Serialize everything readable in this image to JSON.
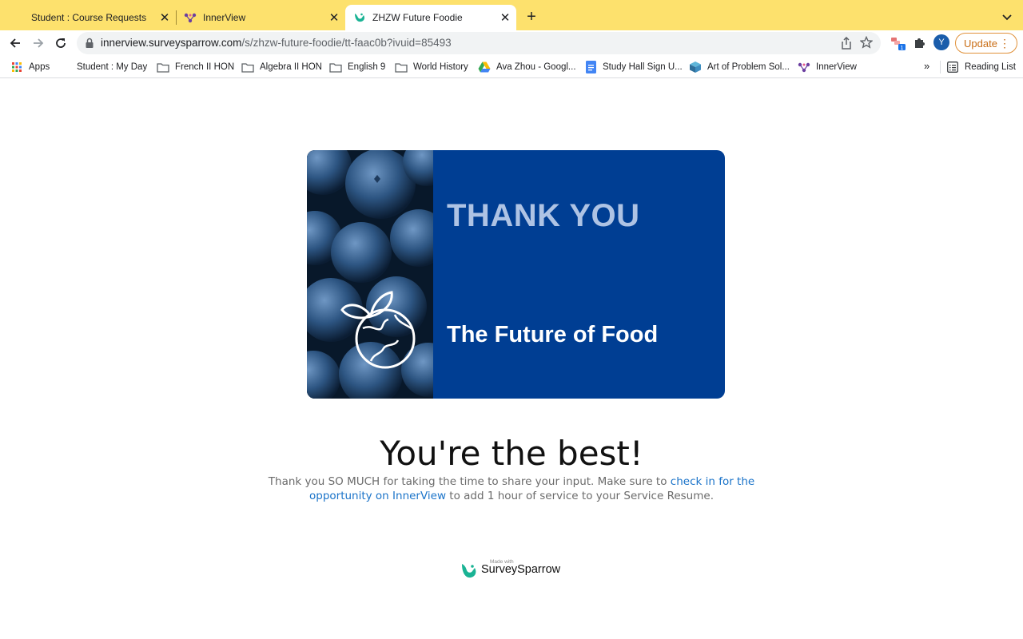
{
  "tabs": [
    {
      "title": "Student : Course Requests",
      "active": false,
      "icon": "none"
    },
    {
      "title": "InnerView",
      "active": false,
      "icon": "innerview-icon"
    },
    {
      "title": "ZHZW Future Foodie",
      "active": true,
      "icon": "surveysparrow-icon"
    }
  ],
  "toolbar": {
    "url_domain": "innerview.surveysparrow.com",
    "url_path": "/s/zhzw-future-foodie/tt-faac0b?ivuid=85493",
    "avatar_letter": "Y",
    "update_label": "Update",
    "extension_badge": "1"
  },
  "bookmarks": {
    "items": [
      {
        "label": "Apps",
        "icon": "apps-grid-icon"
      },
      {
        "label": "Student : My Day",
        "icon": "none"
      },
      {
        "label": "French II HON",
        "icon": "folder-icon"
      },
      {
        "label": "Algebra II HON",
        "icon": "folder-icon"
      },
      {
        "label": "English 9",
        "icon": "folder-icon"
      },
      {
        "label": "World History",
        "icon": "folder-icon"
      },
      {
        "label": "Ava Zhou - Googl...",
        "icon": "google-drive-icon"
      },
      {
        "label": "Study Hall Sign U...",
        "icon": "google-docs-icon"
      },
      {
        "label": "Art of Problem Sol...",
        "icon": "aops-icon"
      },
      {
        "label": "InnerView",
        "icon": "innerview-icon"
      }
    ],
    "more": "»",
    "reading_list": "Reading List"
  },
  "page": {
    "card_title": "THANK YOU",
    "card_subtitle": "The Future of Food",
    "headline": "You're the best!",
    "message_start": "Thank you SO MUCH for taking the time to share your input. Make sure to ",
    "message_link": "check in for the opportunity on InnerView",
    "message_end": " to add 1 hour of service to your Service Resume.",
    "footer_madewith": "Made with",
    "footer_brand": "SurveySparrow"
  },
  "colors": {
    "tabstrip": "#fde16d",
    "card_blue": "#003e93",
    "link": "#1a73c9",
    "update": "#c96d14",
    "surveysparrow_green": "#1ab394"
  }
}
